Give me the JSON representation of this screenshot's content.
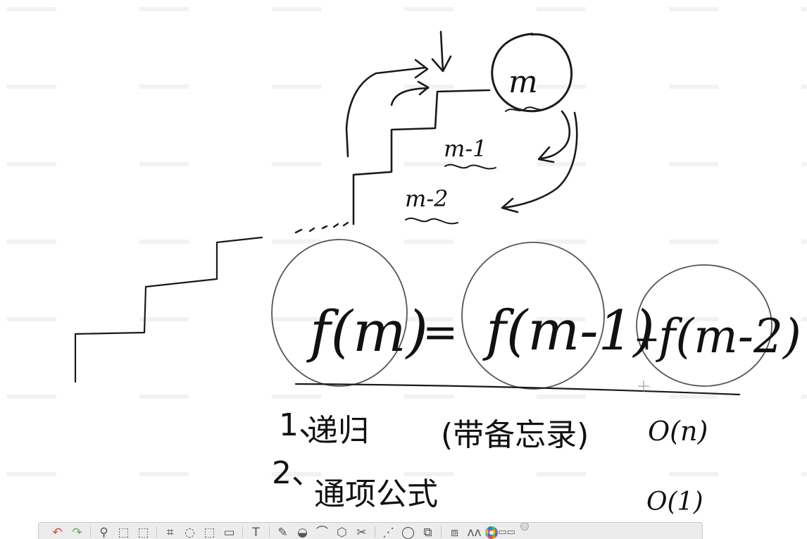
{
  "canvas": {
    "formula": {
      "lhs": "f(m)",
      "equals": "=",
      "term1": "f(m-1)",
      "plus": "+",
      "term2": "f(m-2)"
    },
    "stairs": {
      "top_label": "m",
      "label_m1": "m-1",
      "label_m2": "m-2"
    },
    "notes": [
      {
        "index": "1、",
        "text": "递归",
        "detail": "(带备忘录)",
        "complexity": "O(n)"
      },
      {
        "index": "2、",
        "text": "通项公式",
        "complexity": "O(1)"
      }
    ]
  },
  "toolbar": {
    "tools": [
      {
        "name": "undo-icon",
        "glyph": "↶"
      },
      {
        "name": "redo-icon",
        "glyph": "↷"
      },
      {
        "name": "magnifier-icon",
        "glyph": "⚲"
      },
      {
        "name": "rect-select-icon",
        "glyph": "⬚"
      },
      {
        "name": "select-delete-icon",
        "glyph": "⬚"
      },
      {
        "name": "crop-icon",
        "glyph": "⌗"
      },
      {
        "name": "lasso-icon",
        "glyph": "◌"
      },
      {
        "name": "shape-icon",
        "glyph": "⬚"
      },
      {
        "name": "copy-icon",
        "glyph": "▭"
      },
      {
        "name": "text-icon",
        "glyph": "T"
      },
      {
        "name": "pencil-icon",
        "glyph": "✎"
      },
      {
        "name": "marker-icon",
        "glyph": "◒"
      },
      {
        "name": "brush-icon",
        "glyph": "⌒"
      },
      {
        "name": "cube-icon",
        "glyph": "⬡"
      },
      {
        "name": "scissors-icon",
        "glyph": "✂"
      },
      {
        "name": "dotted-line-icon",
        "glyph": "⋰"
      },
      {
        "name": "circle-shape-icon",
        "glyph": "◯"
      },
      {
        "name": "shapes-icon",
        "glyph": "⧉"
      },
      {
        "name": "stamp-icon",
        "glyph": "⧈"
      },
      {
        "name": "pens-icon",
        "glyph": "ʌʌ"
      }
    ],
    "colors": {
      "undo": "#d9492c",
      "redo": "#5bb04a"
    }
  }
}
